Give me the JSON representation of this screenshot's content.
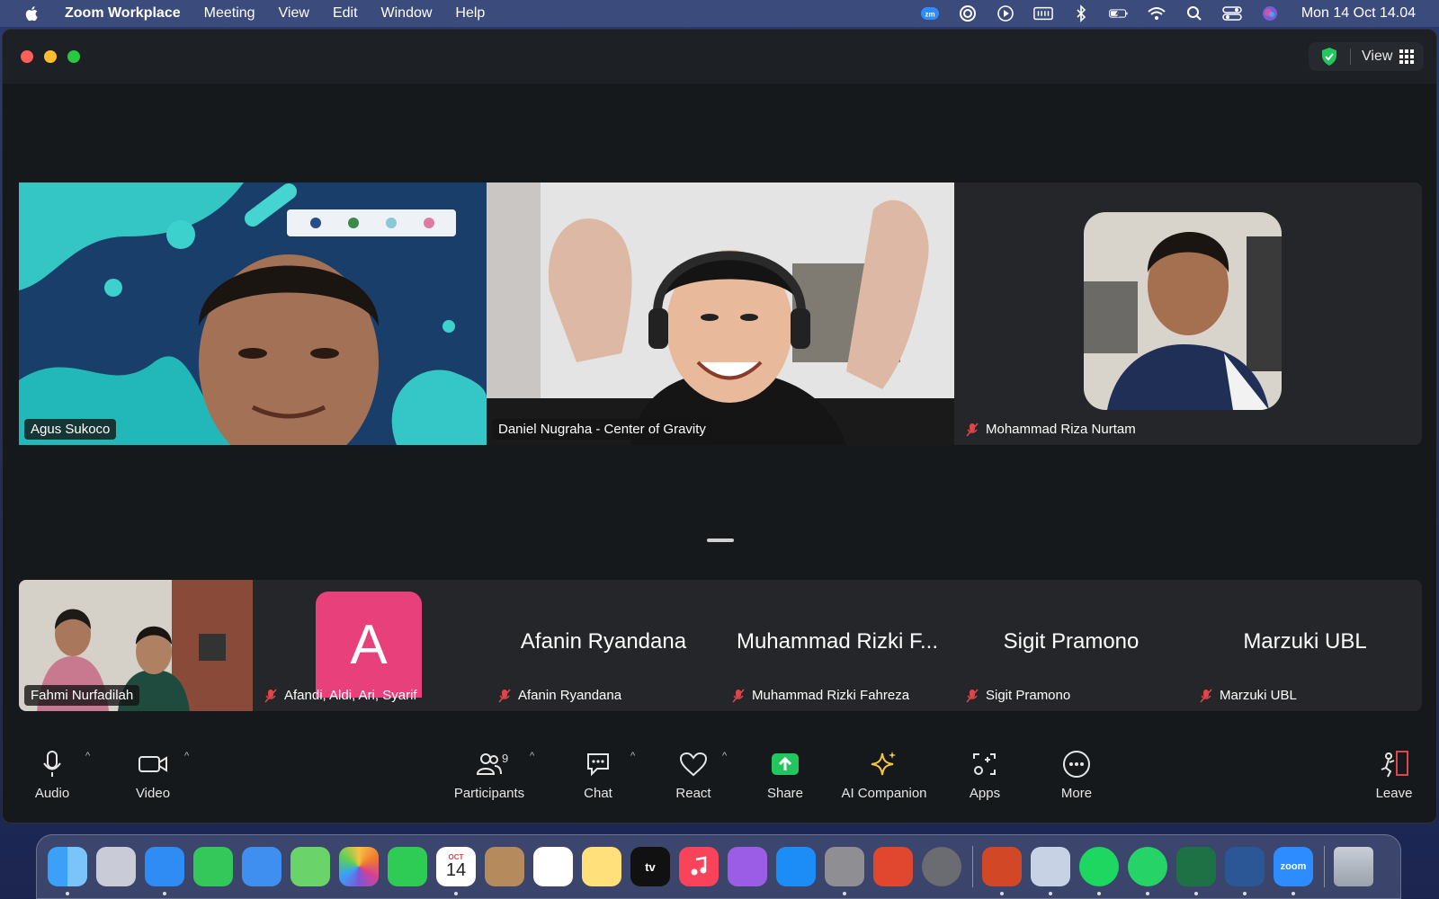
{
  "menubar": {
    "app_name": "Zoom Workplace",
    "items": [
      "Meeting",
      "View",
      "Edit",
      "Window",
      "Help"
    ],
    "clock": "Mon 14 Oct  14.04",
    "tray_icons": [
      "zoom-tray-icon",
      "focus-icon",
      "play-icon",
      "keyboard-icon",
      "bluetooth-icon",
      "battery-icon",
      "wifi-icon",
      "spotlight-icon",
      "control-center-icon",
      "siri-icon"
    ]
  },
  "window": {
    "view_label": "View"
  },
  "speakers": [
    {
      "name": "Agus Sukoco",
      "muted": false
    },
    {
      "name": "Daniel Nugraha - Center of Gravity",
      "muted": false
    },
    {
      "name": "Mohammad Riza Nurtam",
      "muted": true
    }
  ],
  "strip": [
    {
      "name": "Fahmi Nurfadilah",
      "muted": false,
      "display": ""
    },
    {
      "name": "Afandi, Aldi, Ari, Syarif",
      "muted": true,
      "display": "",
      "avatar_letter": "A"
    },
    {
      "name": "Afanin Ryandana",
      "muted": true,
      "display": "Afanin Ryandana"
    },
    {
      "name": "Muhammad Rizki Fahreza",
      "muted": true,
      "display": "Muhammad Rizki F..."
    },
    {
      "name": "Sigit Pramono",
      "muted": true,
      "display": "Sigit Pramono"
    },
    {
      "name": "Marzuki UBL",
      "muted": true,
      "display": "Marzuki UBL"
    }
  ],
  "toolbar": {
    "audio": "Audio",
    "video": "Video",
    "participants": "Participants",
    "participants_count": "9",
    "chat": "Chat",
    "react": "React",
    "share": "Share",
    "ai_companion": "AI Companion",
    "apps": "Apps",
    "more": "More",
    "leave": "Leave"
  },
  "dock": {
    "calendar_month": "OCT",
    "calendar_day": "14",
    "tv_label": "tv",
    "zoom_label": "zoom"
  },
  "colors": {
    "share_green": "#23c55e",
    "avatar_pink": "#e8407a",
    "mute_red": "#e0454b",
    "leave_red": "#e0454b"
  }
}
